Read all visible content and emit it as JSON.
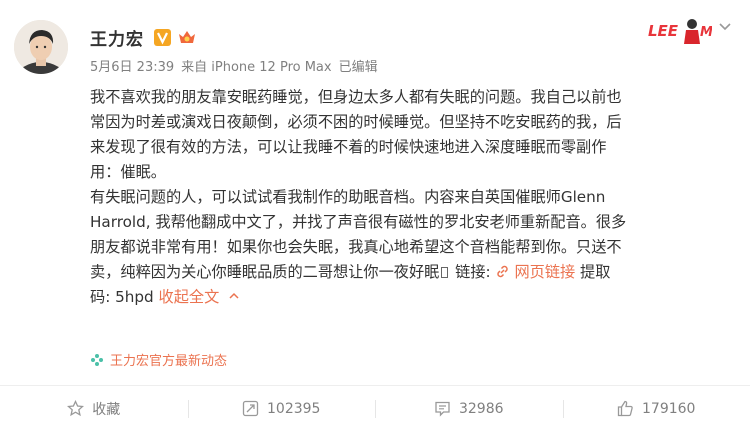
{
  "post": {
    "author": "王力宏",
    "meta": {
      "date": "5月6日 23:39",
      "source": "来自 iPhone 12 Pro Max",
      "edited": "已编辑"
    },
    "content": {
      "lines": [
        "我不喜欢我的朋友靠安眠药睡觉，但身边太多人都有失眠的问题。我自己以前也",
        "常因为时差或演戏日夜颠倒，必须不困的时候睡觉。但坚持不吃安眠药的我，后",
        "来发现了很有效的方法，可以让我睡不着的时候快速地进入深度睡眠而零副作",
        "用：催眠。",
        "有失眠问题的人，可以试试看我制作的助眠音档。内容来自英国催眠师Glenn",
        "Harrold, 我帮他翻成中文了，并找了声音很有磁性的罗北安老师重新配音。很多",
        "朋友都说非常有用！如果你也会失眠，我真心地希望这个音档能帮到你。只送不"
      ],
      "line8_text": "卖，纯粹因为关心你睡眠品质的二哥想让你一夜好眠",
      "line8_after_glyph": " 链接: ",
      "web_link": "网页链接",
      "line8_end": " 提取",
      "line9_text": "码: 5hpd ",
      "collapse": "收起全文"
    },
    "source_topic": "王力宏官方最新动态",
    "actions": {
      "favorite": "收藏",
      "repost": "102395",
      "comment": "32986",
      "like": "179160"
    },
    "colors": {
      "link": "#eb7350",
      "meta": "#808080",
      "text": "#333333"
    }
  }
}
